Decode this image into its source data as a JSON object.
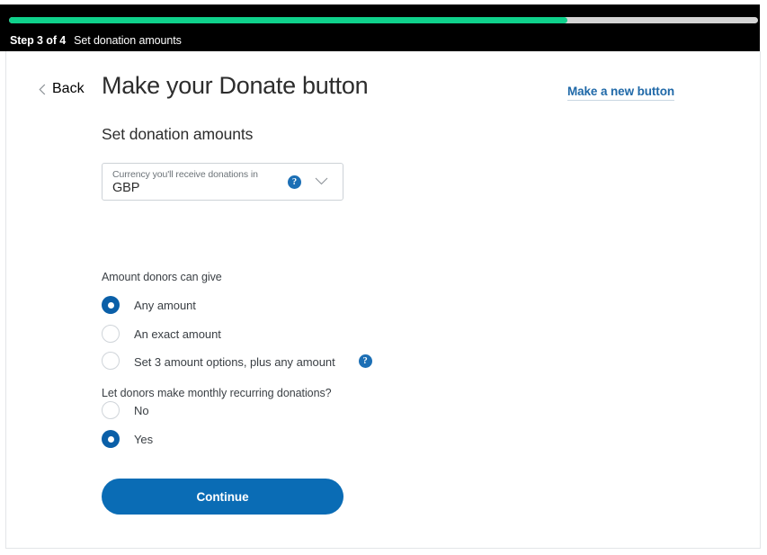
{
  "stepbar": {
    "step_label": "Step 3 of 4",
    "step_name": "Set donation amounts",
    "progress_percent": 74.5,
    "fill_color": "#0fd18c",
    "track_color": "#d4d4d4",
    "background_color": "#000000"
  },
  "header": {
    "back_label": "Back",
    "title": "Make your Donate button",
    "new_button_link": "Make a new button",
    "link_color": "#2069a8"
  },
  "main": {
    "section_heading": "Set donation amounts",
    "currency": {
      "label": "Currency you'll receive donations in",
      "value": "GBP",
      "help_glyph": "?"
    },
    "amount_group": {
      "label": "Amount donors can give",
      "options": [
        {
          "label": "Any amount",
          "selected": true,
          "has_help": false
        },
        {
          "label": "An exact amount",
          "selected": false,
          "has_help": false
        },
        {
          "label": "Set 3 amount options, plus any amount",
          "selected": false,
          "has_help": true
        }
      ]
    },
    "recurring_group": {
      "label": "Let donors make monthly recurring donations?",
      "options": [
        {
          "label": "No",
          "selected": false
        },
        {
          "label": "Yes",
          "selected": true
        }
      ]
    },
    "continue_label": "Continue",
    "accent_color": "#0a6cb5",
    "selected_radio_color": "#0a5fa8"
  }
}
